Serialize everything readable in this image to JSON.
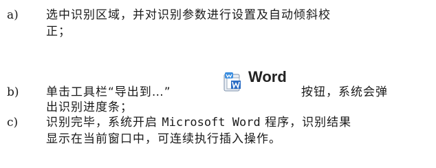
{
  "items": [
    {
      "marker": "a)",
      "lines": [
        "选中识别区域，并对识别参数进行设置及自动倾斜校",
        "正；"
      ]
    },
    {
      "marker": "b)",
      "line1_head": "单击工具栏“导出到…”",
      "button_icon": "word-export-icon",
      "button_label": "Word",
      "line1_tail": "按钮，系统会弹",
      "line2": "出识别进度条；"
    },
    {
      "marker": "c)",
      "line1_head": "识别完毕，系统开启 ",
      "line1_mono": "Microsoft Word",
      "line1_tail": " 程序，识别结果",
      "line2": "显示在当前窗口中，可连续执行插入操作。"
    }
  ]
}
